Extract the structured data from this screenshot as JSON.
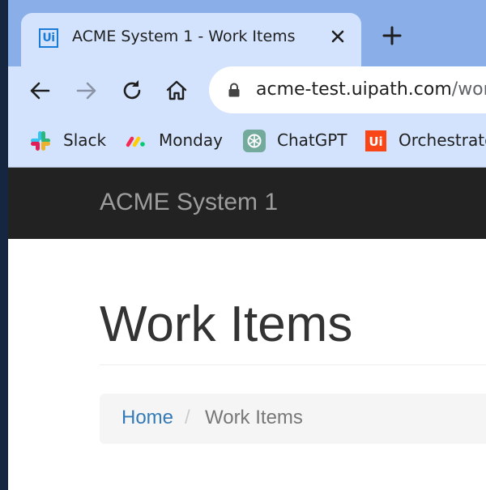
{
  "browser": {
    "tab": {
      "favicon_text": "Ui",
      "title": "ACME System 1 - Work Items",
      "close_glyph": "✕"
    },
    "new_tab_glyph": "+",
    "toolbar": {
      "url_host": "acme-test.uipath.com",
      "url_rest": "/wor"
    },
    "bookmarks": [
      {
        "label": "Slack",
        "icon": "slack-icon"
      },
      {
        "label": "Monday",
        "icon": "monday-icon"
      },
      {
        "label": "ChatGPT",
        "icon": "chatgpt-icon"
      },
      {
        "label": "Orchestrato",
        "icon": "uipath-icon"
      }
    ],
    "colors": {
      "tabstrip": "#8aaee8",
      "toolbar": "#d3e3fd"
    }
  },
  "app": {
    "brand": "ACME System 1",
    "page_title": "Work Items",
    "breadcrumb": {
      "home": "Home",
      "separator": "/",
      "current": "Work Items"
    },
    "colors": {
      "navbar": "#222222",
      "link": "#337ab7"
    }
  }
}
